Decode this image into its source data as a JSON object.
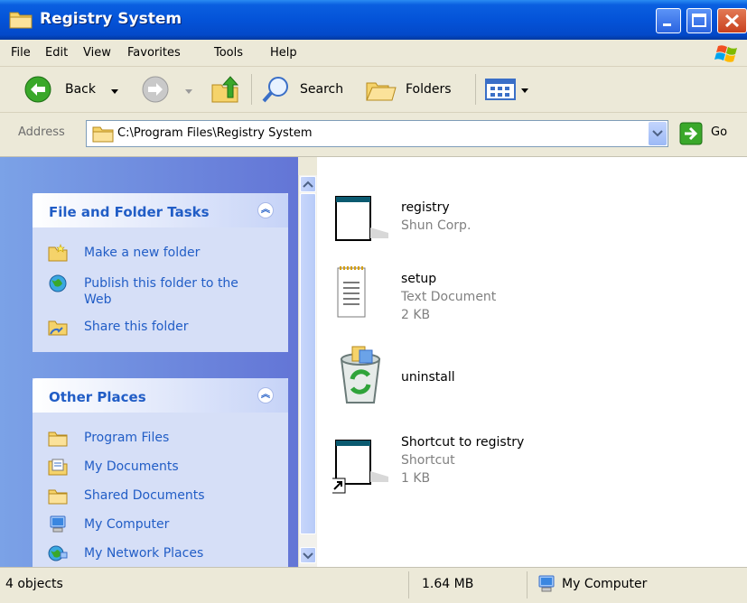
{
  "window": {
    "title": "Registry System"
  },
  "menu": [
    "File",
    "Edit",
    "View",
    "Favorites",
    "Tools",
    "Help"
  ],
  "toolbar": {
    "back": "Back",
    "search": "Search",
    "folders": "Folders"
  },
  "address": {
    "label": "Address",
    "path": "C:\\Program Files\\Registry System",
    "go": "Go"
  },
  "tasks_panel": {
    "title": "File and Folder Tasks",
    "items": [
      "Make a new folder",
      "Publish this folder to the Web",
      "Share this folder"
    ]
  },
  "places_panel": {
    "title": "Other Places",
    "items": [
      "Program Files",
      "My Documents",
      "Shared Documents",
      "My Computer",
      "My Network Places"
    ]
  },
  "files": [
    {
      "name": "registry",
      "line2": "Shun Corp.",
      "line3": ""
    },
    {
      "name": "setup",
      "line2": "Text Document",
      "line3": "2 KB"
    },
    {
      "name": "uninstall",
      "line2": "",
      "line3": ""
    },
    {
      "name": "Shortcut to registry",
      "line2": "Shortcut",
      "line3": "1 KB"
    }
  ],
  "status": {
    "objects": "4 objects",
    "size": "1.64 MB",
    "location": "My Computer"
  },
  "colors": {
    "title_bar": "#0453d8",
    "task_link": "#215dc6",
    "task_pane": "#7ba2e7"
  }
}
